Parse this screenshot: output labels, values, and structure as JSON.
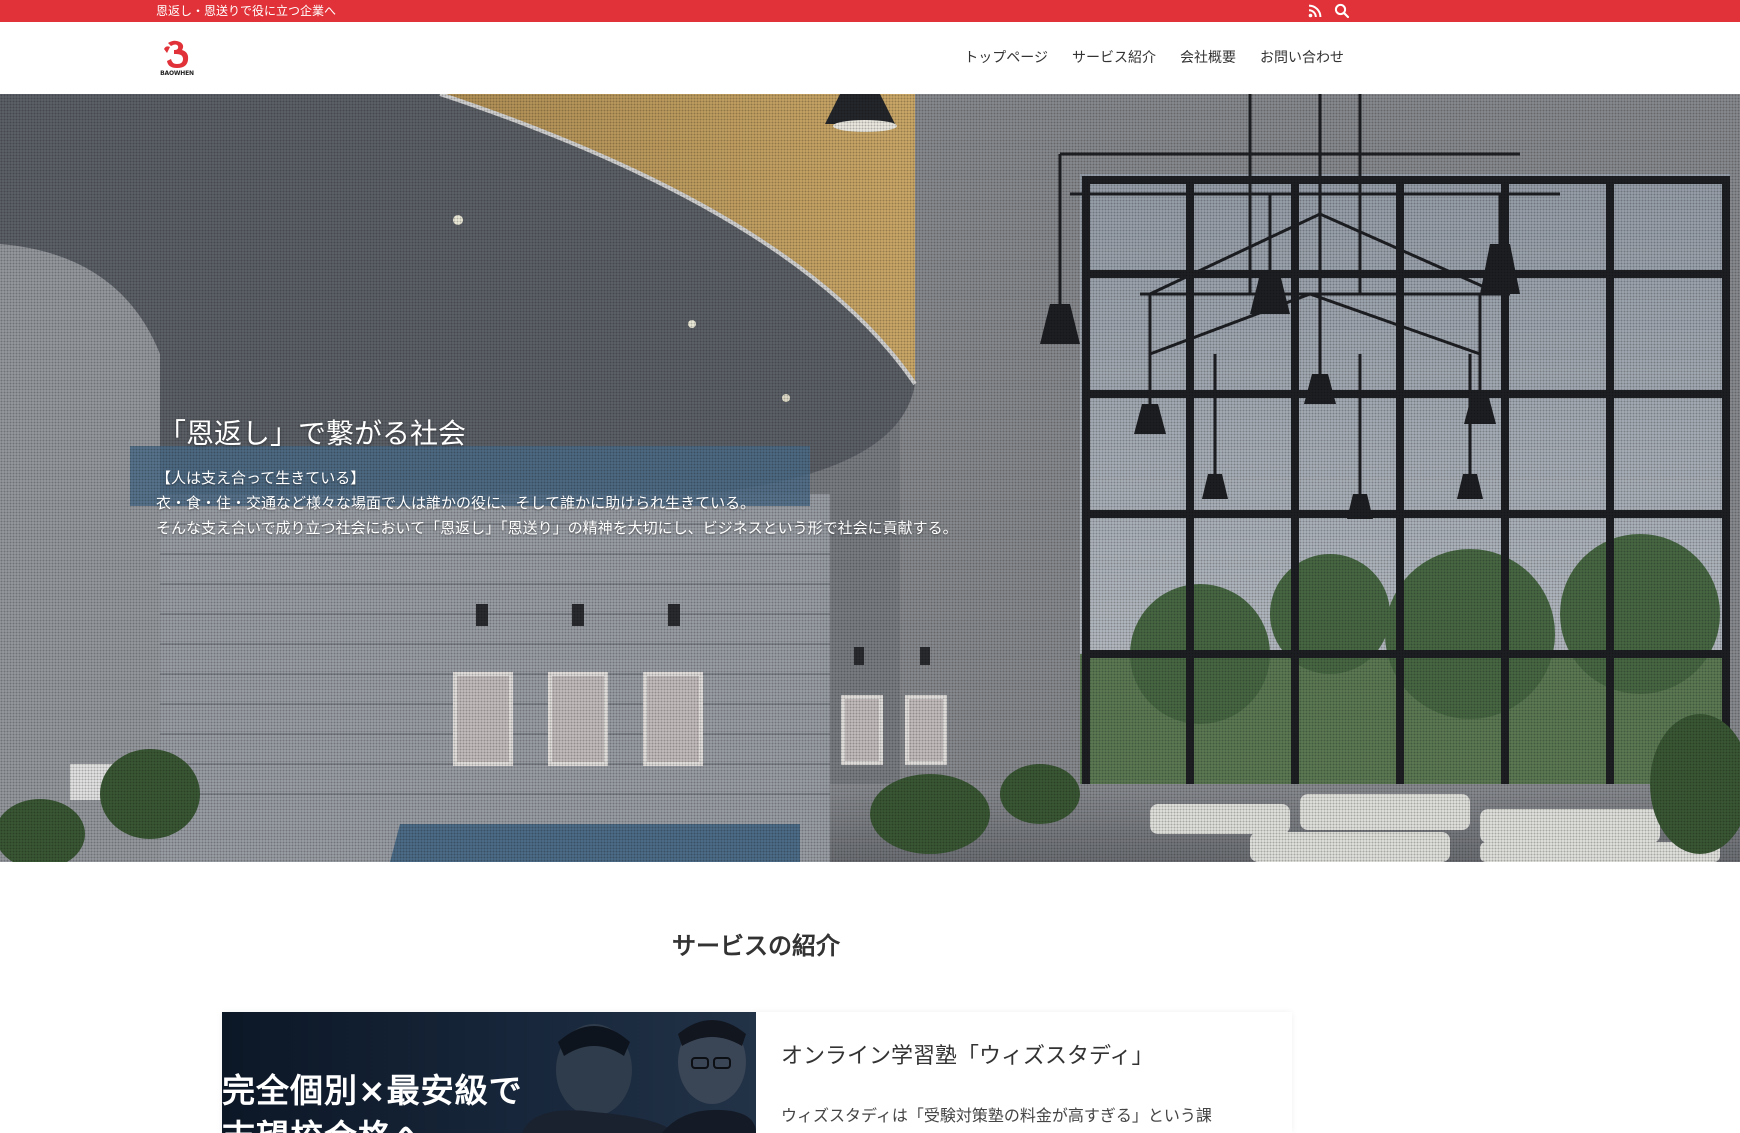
{
  "colors": {
    "accent_red": "#e03238",
    "header_bg": "#ffffff",
    "text": "#333333"
  },
  "topbar": {
    "tagline": "恩返し・恩送りで役に立つ企業へ",
    "icons": [
      "rss-icon",
      "search-icon"
    ]
  },
  "header": {
    "logo_text": "BAOWHEN",
    "nav": [
      {
        "label": "トップページ"
      },
      {
        "label": "サービス紹介"
      },
      {
        "label": "会社概要"
      },
      {
        "label": "お問い合わせ"
      }
    ]
  },
  "hero": {
    "title": "「恩返し」で繋がる社会",
    "lines": [
      "【人は支え合って生きている】",
      "衣・食・住・交通など様々な場面で人は誰かの役に、そして誰かに助けられ生きている。",
      "そんな支え合いで成り立つ社会において「恩返し」「恩送り」の精神を大切にし、ビジネスという形で社会に貢献する。"
    ]
  },
  "services": {
    "heading": "サービスの紹介",
    "items": [
      {
        "image_text_line1": "完全個別×最安級で",
        "image_text_line2": "志望校合格へ",
        "name": "オンライン学習塾「ウィズスタディ」",
        "description": "ウィズスタディは「受験対策塾の料金が高すぎる」という課"
      }
    ]
  }
}
